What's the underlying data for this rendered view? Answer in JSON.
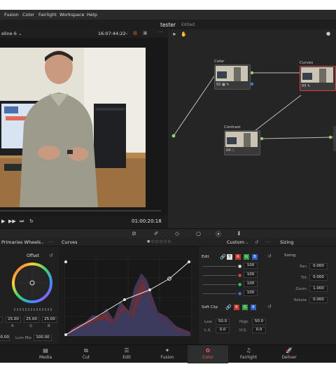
{
  "menu": [
    "Fusion",
    "Color",
    "Fairlight",
    "Workspace",
    "Help"
  ],
  "project": {
    "name": "tester",
    "status": "Edited"
  },
  "viewer": {
    "timeline": "eline 6",
    "source_timecode": "16:07:44:22",
    "playhead_timecode": "01:00:20:18"
  },
  "nodes": [
    {
      "title": "Color",
      "id": "02"
    },
    {
      "title": "Curves",
      "id": "03"
    },
    {
      "title": "Contrast",
      "id": "04"
    }
  ],
  "panels": {
    "wheels_title": "Primaries Wheels",
    "wheel_name": "Offset",
    "rgb_values": [
      "25.00",
      "25.00",
      "25.00"
    ],
    "rgb_labels": [
      "R",
      "G",
      "B"
    ],
    "left_value": "00.00",
    "lum_mix_label": "Lum Mix",
    "lum_mix_value": "100.00",
    "curves_title": "Curves",
    "curves_mode": "Custom",
    "edit_label": "Edit",
    "edit_channels": [
      "Y",
      "R",
      "G",
      "B"
    ],
    "edit_values": [
      "100",
      "100",
      "100",
      "100"
    ],
    "soft_clip_label": "Soft Clip",
    "soft_clip": {
      "low_label": "Low",
      "low": "50.0",
      "high_label": "High",
      "high": "50.0",
      "ls_label": "L.S.",
      "ls": "0.0",
      "hs_label": "H.S.",
      "hs": "0.0"
    },
    "sizing_title": "Sizing",
    "sizing_sub": "Sizing",
    "sizing_rows": [
      {
        "label": "Pan",
        "value": "0.000"
      },
      {
        "label": "Tilt",
        "value": "0.000"
      },
      {
        "label": "Zoom",
        "value": "1.000"
      },
      {
        "label": "Rotate",
        "value": "0.000"
      }
    ]
  },
  "pages": [
    {
      "label": "Media",
      "icon": "media-icon"
    },
    {
      "label": "Cut",
      "icon": "cut-icon"
    },
    {
      "label": "Edit",
      "icon": "edit-icon"
    },
    {
      "label": "Fusion",
      "icon": "fusion-icon"
    },
    {
      "label": "Color",
      "icon": "color-icon",
      "active": true
    },
    {
      "label": "Fairlight",
      "icon": "fairlight-icon"
    },
    {
      "label": "Deliver",
      "icon": "deliver-icon"
    }
  ],
  "colors": {
    "accent": "#ff5a5a",
    "node_link": "#9bd36b",
    "curve_red": "#c0392b",
    "curve_blue": "#2f5fbf"
  }
}
